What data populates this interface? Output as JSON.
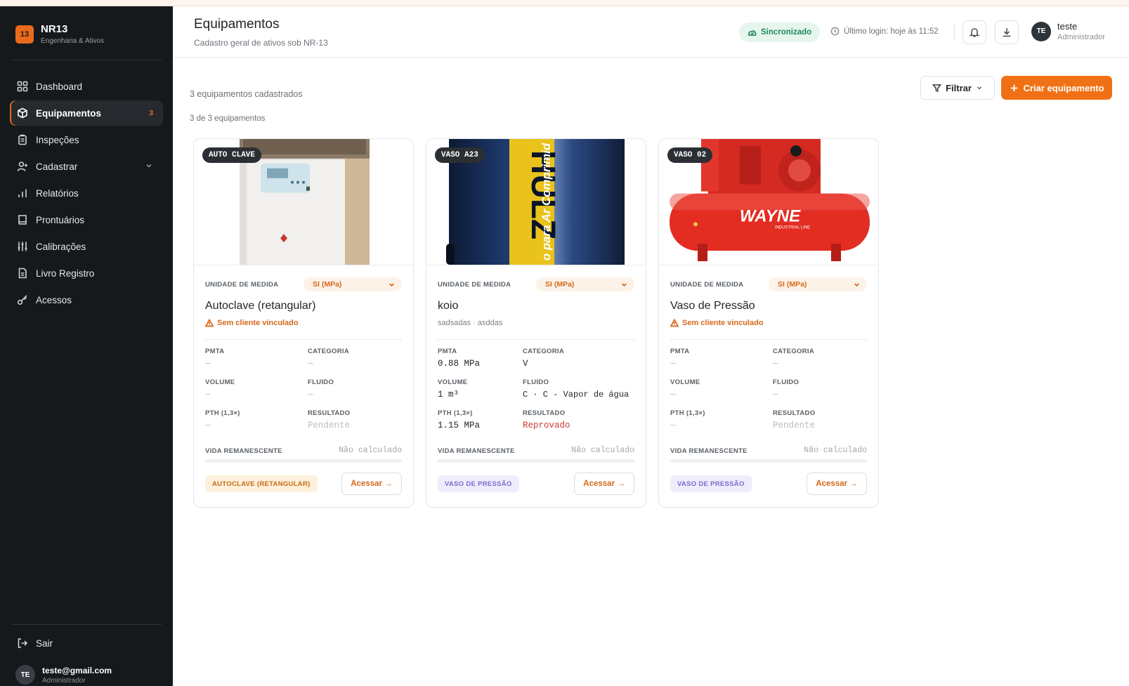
{
  "sidebar": {
    "brand": {
      "logo": "13",
      "name": "NR13",
      "subtitle": "Engenharia & Ativos"
    },
    "items": [
      {
        "label": "Dashboard",
        "icon": "grid-icon"
      },
      {
        "label": "Equipamentos",
        "icon": "box-icon",
        "badge": "3",
        "active": true
      },
      {
        "label": "Inspeções",
        "icon": "clipboard-icon"
      },
      {
        "label": "Cadastrar",
        "icon": "user-plus-icon",
        "has_submenu": true
      },
      {
        "label": "Relatórios",
        "icon": "bar-chart-icon"
      },
      {
        "label": "Prontuários",
        "icon": "book-icon"
      },
      {
        "label": "Calibrações",
        "icon": "sliders-icon"
      },
      {
        "label": "Livro Registro",
        "icon": "file-icon"
      },
      {
        "label": "Acessos",
        "icon": "key-icon"
      }
    ],
    "logout_label": "Sair",
    "user": {
      "initials": "TE",
      "email": "teste@gmail.com",
      "role": "Administrador"
    }
  },
  "header": {
    "title": "Equipamentos",
    "subtitle": "Cadastro geral de ativos sob NR-13",
    "sync_status": "Sincronizado",
    "last_login": "Último login: hoje às 11:52",
    "user": {
      "initials": "TE",
      "name": "teste",
      "role": "Administrador"
    }
  },
  "toolbar": {
    "count_text": "3 equipamentos cadastrados",
    "showing_text": "3 de 3 equipamentos",
    "filter_label": "Filtrar",
    "create_label": "Criar equipamento"
  },
  "labels": {
    "unit": "UNIDADE DE MEDIDA",
    "pmta": "PMTA",
    "categoria": "CATEGORIA",
    "volume": "VOLUME",
    "fluido": "FLUIDO",
    "pth": "PTH (1,3×)",
    "resultado": "RESULTADO",
    "vida": "VIDA REMANESCENTE",
    "access": "Acessar →"
  },
  "cards": [
    {
      "tag": "AUTO CLAVE",
      "unit": "SI (MPa)",
      "title": "Autoclave (retangular)",
      "warning": "Sem cliente vinculado",
      "pmta": "—",
      "categoria": "—",
      "volume": "—",
      "fluido": "—",
      "pth": "—",
      "resultado": "Pendente",
      "vida": "Não calculado",
      "vida_fraction": 0,
      "type_chip": "AUTOCLAVE (RETANGULAR)"
    },
    {
      "tag": "VASO A23",
      "unit": "SI (MPa)",
      "title": "koio",
      "client": "sadsadas · asddas",
      "pmta": "0.88 MPa",
      "categoria": "V",
      "volume": "1 m³",
      "fluido": "C · C - Vapor de água",
      "pth": "1.15 MPa",
      "resultado": "Reprovado",
      "vida": "Não calculado",
      "vida_fraction": 0,
      "type_chip": "VASO DE PRESSÃO"
    },
    {
      "tag": "VASO 02",
      "unit": "SI (MPa)",
      "title": "Vaso de Pressão",
      "warning": "Sem cliente vinculado",
      "pmta": "—",
      "categoria": "—",
      "volume": "—",
      "fluido": "—",
      "pth": "—",
      "resultado": "Pendente",
      "vida": "Não calculado",
      "vida_fraction": 0,
      "type_chip": "VASO DE PRESSÃO"
    }
  ],
  "images": {
    "card_0_brand": "",
    "card_1_text": "HULZ",
    "card_1_text2": "o para Ar Comprimid",
    "card_2_brand": "WAYNE",
    "card_2_sub": "INDUSTRIAL LINE"
  },
  "colors": {
    "accent": "#f07115",
    "sidebar_bg": "#16191c",
    "success": "#1d8a58",
    "danger": "#c9383a"
  }
}
